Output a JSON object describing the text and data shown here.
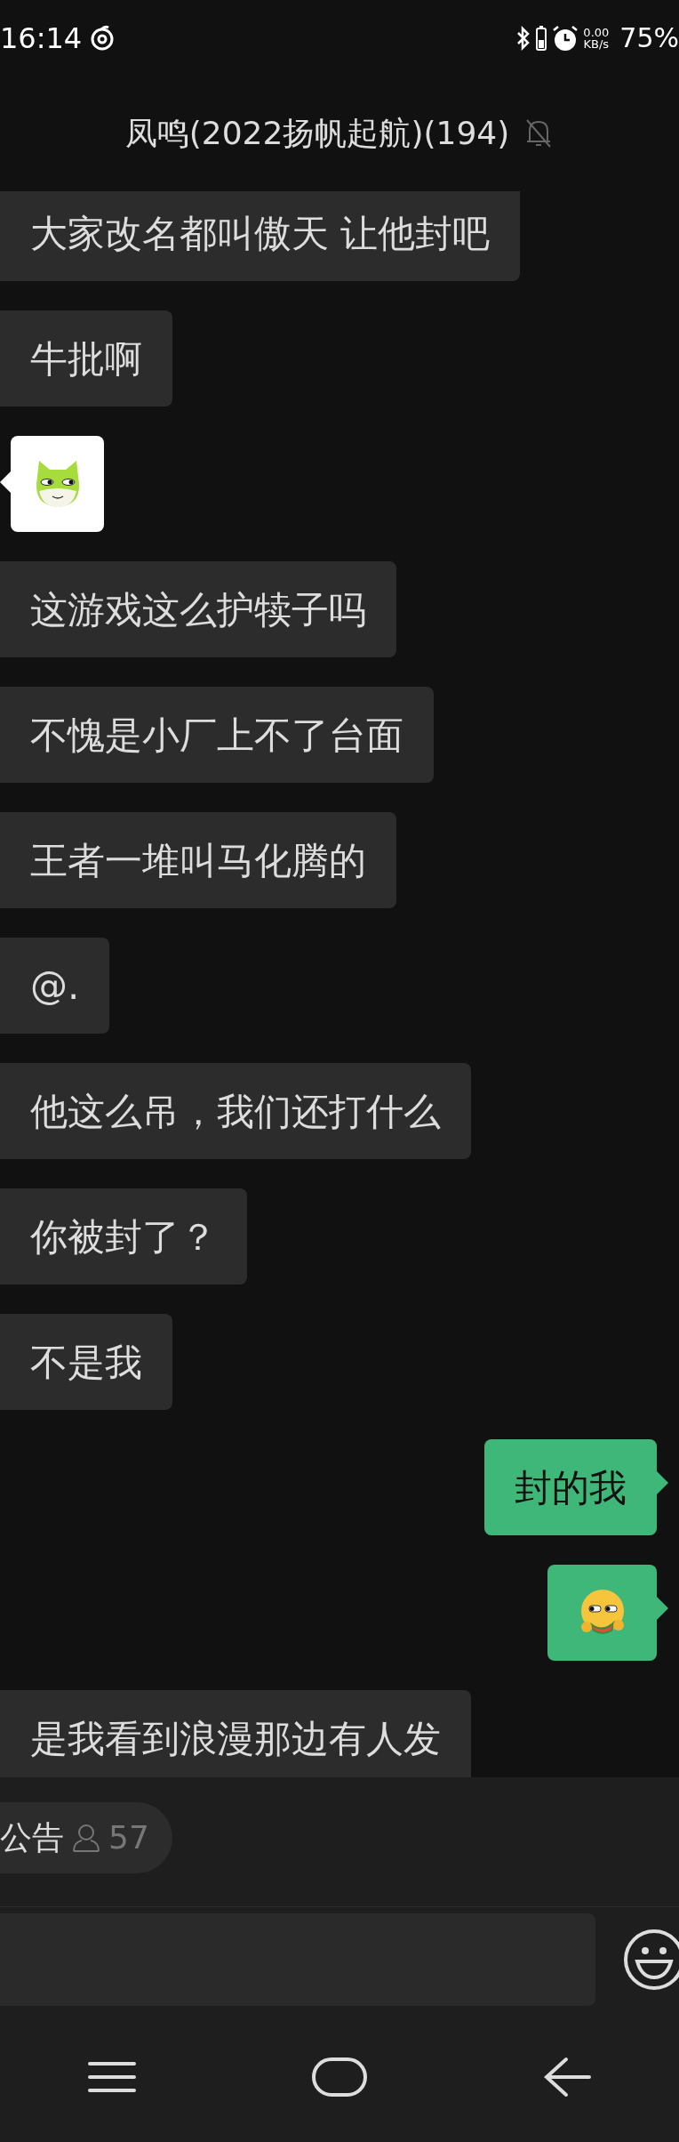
{
  "status_bar": {
    "time": "16:14",
    "net_speed_value": "0.00",
    "net_speed_unit": "KB/s",
    "battery": "75%"
  },
  "header": {
    "title": "凤鸣(2022扬帆起航)(194)",
    "muted": true
  },
  "messages": [
    {
      "outgoing": false,
      "kind": "text",
      "text": "大家改名都叫傲天 让他封吧"
    },
    {
      "outgoing": false,
      "kind": "text",
      "text": "牛批啊"
    },
    {
      "outgoing": false,
      "kind": "sticker"
    },
    {
      "outgoing": false,
      "kind": "text",
      "text": "这游戏这么护犊子吗"
    },
    {
      "outgoing": false,
      "kind": "text",
      "text": "不愧是小厂上不了台面"
    },
    {
      "outgoing": false,
      "kind": "text",
      "text": "王者一堆叫马化腾的"
    },
    {
      "outgoing": false,
      "kind": "text",
      "text": "@."
    },
    {
      "outgoing": false,
      "kind": "text",
      "text": "他这么吊，我们还打什么"
    },
    {
      "outgoing": false,
      "kind": "text",
      "text": "你被封了？"
    },
    {
      "outgoing": false,
      "kind": "text",
      "text": "不是我"
    },
    {
      "outgoing": true,
      "kind": "text",
      "text": "封的我"
    },
    {
      "outgoing": true,
      "kind": "emoji"
    },
    {
      "outgoing": false,
      "kind": "text",
      "text": "是我看到浪漫那边有人发"
    }
  ],
  "announcement": {
    "label": "公告",
    "count": "57"
  }
}
